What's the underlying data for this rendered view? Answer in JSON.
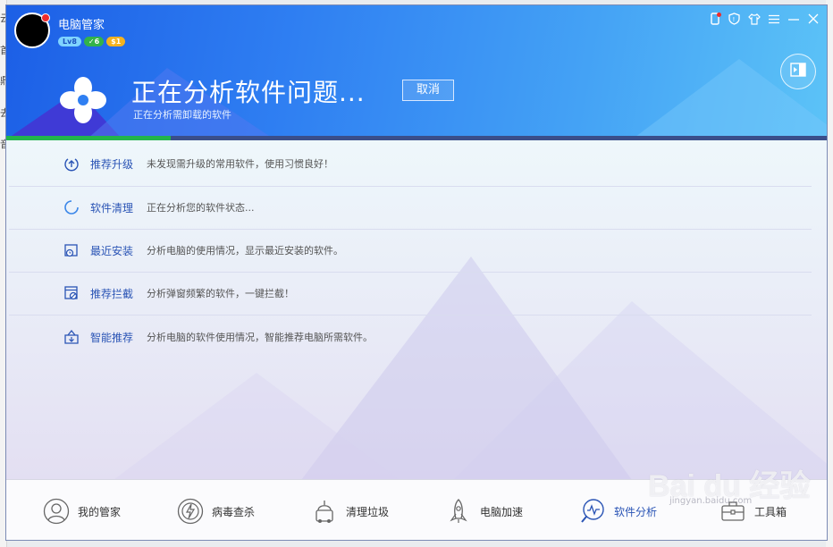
{
  "window": {
    "app_name": "电脑管家",
    "badges": {
      "level": "Lv8",
      "check": "✓6",
      "coin": "$1"
    }
  },
  "header": {
    "title": "正在分析软件问题...",
    "cancel_label": "取消",
    "subtitle": "正在分析需卸载的软件",
    "progress_fraction": 0.2
  },
  "rows": [
    {
      "name": "推荐升级",
      "desc": "未发现需升级的常用软件，使用习惯良好！",
      "icon": "upgrade-icon"
    },
    {
      "name": "软件清理",
      "desc": "正在分析您的软件状态...",
      "icon": "loading-spinner-icon"
    },
    {
      "name": "最近安装",
      "desc": "分析电脑的使用情况，显示最近安装的软件。",
      "icon": "recent-install-icon"
    },
    {
      "name": "推荐拦截",
      "desc": "分析弹窗频繁的软件，一键拦截！",
      "icon": "block-popup-icon"
    },
    {
      "name": "智能推荐",
      "desc": "分析电脑的软件使用情况，智能推荐电脑所需软件。",
      "icon": "smart-recommend-icon"
    }
  ],
  "footer": {
    "nav": [
      {
        "label": "我的管家",
        "icon": "butler-icon"
      },
      {
        "label": "病毒查杀",
        "icon": "virus-scan-icon"
      },
      {
        "label": "清理垃圾",
        "icon": "cleanup-icon"
      },
      {
        "label": "电脑加速",
        "icon": "rocket-icon"
      },
      {
        "label": "软件分析",
        "icon": "software-analysis-icon",
        "active": true
      },
      {
        "label": "工具箱",
        "icon": "toolbox-icon"
      }
    ]
  },
  "watermark": {
    "text": "Bai du 经验",
    "sub": "jingyan.baidu.com"
  },
  "colors": {
    "header_start": "#1c5fe6",
    "header_end": "#5cc3f7",
    "accent": "#2a54b5",
    "progress": "#22b44b"
  }
}
